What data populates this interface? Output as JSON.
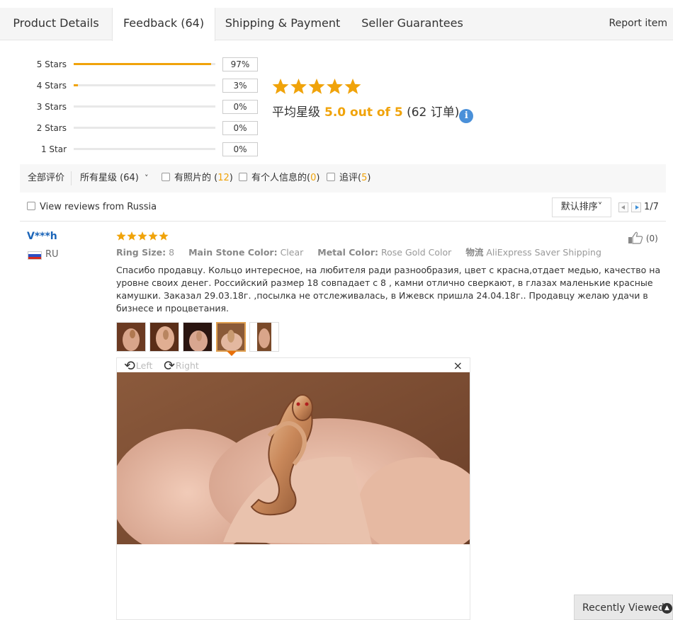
{
  "tabs": [
    {
      "label": "Product Details"
    },
    {
      "label": "Feedback (64)"
    },
    {
      "label": "Shipping & Payment"
    },
    {
      "label": "Seller Guarantees"
    }
  ],
  "report_label": "Report item",
  "histogram": [
    {
      "label": "5 Stars",
      "percent_text": "97%",
      "fill": 0.97
    },
    {
      "label": "4 Stars",
      "percent_text": "3%",
      "fill": 0.03
    },
    {
      "label": "3 Stars",
      "percent_text": "0%",
      "fill": 0
    },
    {
      "label": "2 Stars",
      "percent_text": "0%",
      "fill": 0
    },
    {
      "label": "1 Star",
      "percent_text": "0%",
      "fill": 0
    }
  ],
  "summary": {
    "rating_stars": 5,
    "avg_label": "平均星级",
    "avg_value": "5.0 out of 5",
    "orders": "(62 订单)",
    "info_icon": "i"
  },
  "filters": {
    "all_reviews": "全部评价",
    "all_stars": "所有星级 (64)",
    "chevron": "˅",
    "with_photos_label": "有照片的 (",
    "with_photos_count": "12",
    "with_personal_label": "有个人信息的(",
    "with_personal_count": "0",
    "followup_label": "追评(",
    "followup_count": "5",
    "close_paren": ")"
  },
  "view_russia": "View reviews from Russia",
  "sort_label": "默认排序˅",
  "pager": "1/7",
  "review": {
    "user": "V***h",
    "country": "RU",
    "stars": 5,
    "attributes": [
      {
        "name": "Ring Size:",
        "value": "8"
      },
      {
        "name": "Main Stone Color:",
        "value": "Clear"
      },
      {
        "name": "Metal Color:",
        "value": "Rose Gold Color"
      },
      {
        "name": "物流",
        "value": "AliExpress Saver Shipping"
      }
    ],
    "likes": "(0)",
    "text": "Спасибо продавцу. Кольцо интересное, на любителя ради разнообразия, цвет с красна,отдает медью, качество на уровне своих денег. Российский размер 18 совпадает с 8 , камни отлично сверкают, в глазах маленькие красные камушки. Заказал 29.03.18г. ,посылка не отслеживалась, в Ижевск пришла 24.04.18г.. Продавцу желаю удачи в бизнесе и процветания."
  },
  "viewer": {
    "left_label": "Left",
    "right_label": "Right",
    "close": "×"
  },
  "recently_viewed": "Recently Viewed",
  "colors": {
    "accent": "#f0a30a",
    "link": "#1a64b8",
    "info": "#4a90d9"
  },
  "icons": [
    "rotate-left-icon",
    "rotate-right-icon",
    "close-icon",
    "thumb-up-icon",
    "info-icon",
    "chevron-up-icon",
    "flag-ru-icon"
  ]
}
